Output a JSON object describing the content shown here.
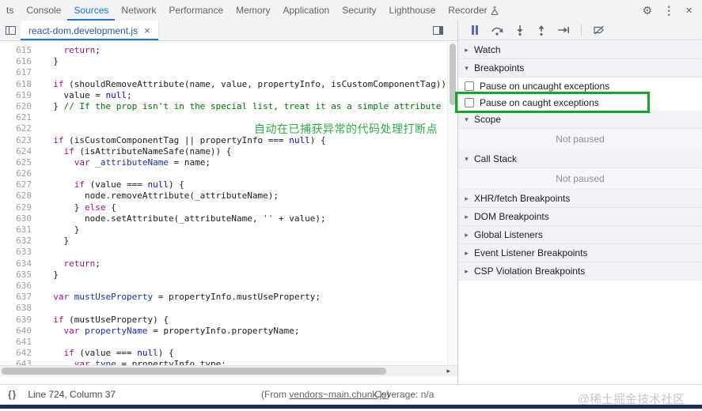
{
  "colors": {
    "accent": "#1a73e8",
    "highlight_green": "#17a527",
    "annotation_green": "#2fad44"
  },
  "top_bar": {
    "tabs": [
      {
        "label": "ts",
        "active": false
      },
      {
        "label": "Console",
        "active": false
      },
      {
        "label": "Sources",
        "active": true
      },
      {
        "label": "Network",
        "active": false
      },
      {
        "label": "Performance",
        "active": false
      },
      {
        "label": "Memory",
        "active": false
      },
      {
        "label": "Application",
        "active": false
      },
      {
        "label": "Security",
        "active": false
      },
      {
        "label": "Lighthouse",
        "active": false
      },
      {
        "label": "Recorder",
        "active": false,
        "experimental": true
      }
    ],
    "icons": {
      "settings": "⚙",
      "more": "⋮",
      "close": "×"
    }
  },
  "file_tab_bar": {
    "tab": {
      "name": "react-dom.development.js",
      "close": "×"
    }
  },
  "editor": {
    "annotation": {
      "text": "自动在已捕获异常的代码处理打断点",
      "line": 622
    },
    "lines": [
      {
        "n": 615,
        "seg": [
          [
            "p",
            "    "
          ],
          [
            "k",
            "return"
          ],
          [
            "p",
            ";"
          ]
        ]
      },
      {
        "n": 616,
        "seg": [
          [
            "p",
            "  }"
          ]
        ]
      },
      {
        "n": 617,
        "seg": []
      },
      {
        "n": 618,
        "seg": [
          [
            "p",
            "  "
          ],
          [
            "k",
            "if"
          ],
          [
            "p",
            " (shouldRemoveAttribute(name, value, propertyInfo, isCustomComponentTag)) {"
          ]
        ]
      },
      {
        "n": 619,
        "seg": [
          [
            "p",
            "    value = "
          ],
          [
            "a",
            "null"
          ],
          [
            "p",
            ";"
          ]
        ]
      },
      {
        "n": 620,
        "seg": [
          [
            "p",
            "  } "
          ],
          [
            "c",
            "// If the prop isn't in the special list, treat it as a simple attribute"
          ]
        ]
      },
      {
        "n": 621,
        "seg": []
      },
      {
        "n": 622,
        "seg": []
      },
      {
        "n": 623,
        "seg": [
          [
            "p",
            "  "
          ],
          [
            "k",
            "if"
          ],
          [
            "p",
            " (isCustomComponentTag || propertyInfo === "
          ],
          [
            "a",
            "null"
          ],
          [
            "p",
            ") {"
          ]
        ]
      },
      {
        "n": 624,
        "seg": [
          [
            "p",
            "    "
          ],
          [
            "k",
            "if"
          ],
          [
            "p",
            " (isAttributeNameSafe(name)) {"
          ]
        ]
      },
      {
        "n": 625,
        "seg": [
          [
            "p",
            "      "
          ],
          [
            "k",
            "var"
          ],
          [
            "p",
            " "
          ],
          [
            "d",
            "_attributeName"
          ],
          [
            "p",
            " = name;"
          ]
        ]
      },
      {
        "n": 626,
        "seg": []
      },
      {
        "n": 627,
        "seg": [
          [
            "p",
            "      "
          ],
          [
            "k",
            "if"
          ],
          [
            "p",
            " (value === "
          ],
          [
            "a",
            "null"
          ],
          [
            "p",
            ") {"
          ]
        ]
      },
      {
        "n": 628,
        "seg": [
          [
            "p",
            "        node.removeAttribute(_attributeName);"
          ]
        ]
      },
      {
        "n": 629,
        "seg": [
          [
            "p",
            "      } "
          ],
          [
            "k",
            "else"
          ],
          [
            "p",
            " {"
          ]
        ]
      },
      {
        "n": 630,
        "seg": [
          [
            "p",
            "        node.setAttribute(_attributeName, "
          ],
          [
            "s",
            "''"
          ],
          [
            "p",
            " + value);"
          ]
        ]
      },
      {
        "n": 631,
        "seg": [
          [
            "p",
            "      }"
          ]
        ]
      },
      {
        "n": 632,
        "seg": [
          [
            "p",
            "    }"
          ]
        ]
      },
      {
        "n": 633,
        "seg": []
      },
      {
        "n": 634,
        "seg": [
          [
            "p",
            "    "
          ],
          [
            "k",
            "return"
          ],
          [
            "p",
            ";"
          ]
        ]
      },
      {
        "n": 635,
        "seg": [
          [
            "p",
            "  }"
          ]
        ]
      },
      {
        "n": 636,
        "seg": []
      },
      {
        "n": 637,
        "seg": [
          [
            "p",
            "  "
          ],
          [
            "k",
            "var"
          ],
          [
            "p",
            " "
          ],
          [
            "d",
            "mustUseProperty"
          ],
          [
            "p",
            " = propertyInfo.mustUseProperty;"
          ]
        ]
      },
      {
        "n": 638,
        "seg": []
      },
      {
        "n": 639,
        "seg": [
          [
            "p",
            "  "
          ],
          [
            "k",
            "if"
          ],
          [
            "p",
            " (mustUseProperty) {"
          ]
        ]
      },
      {
        "n": 640,
        "seg": [
          [
            "p",
            "    "
          ],
          [
            "k",
            "var"
          ],
          [
            "p",
            " "
          ],
          [
            "d",
            "propertyName"
          ],
          [
            "p",
            " = propertyInfo.propertyName;"
          ]
        ]
      },
      {
        "n": 641,
        "seg": []
      },
      {
        "n": 642,
        "seg": [
          [
            "p",
            "    "
          ],
          [
            "k",
            "if"
          ],
          [
            "p",
            " (value === "
          ],
          [
            "a",
            "null"
          ],
          [
            "p",
            ") {"
          ]
        ]
      },
      {
        "n": 643,
        "seg": [
          [
            "p",
            "      "
          ],
          [
            "k",
            "var"
          ],
          [
            "p",
            " "
          ],
          [
            "d",
            "type"
          ],
          [
            "p",
            " = propertyInfo.type;"
          ]
        ]
      }
    ]
  },
  "sidebar": {
    "triangle_collapsed": "▸",
    "triangle_expanded": "▾",
    "sections": [
      {
        "label": "Watch",
        "expanded": false
      },
      {
        "label": "Breakpoints",
        "expanded": true,
        "items": [
          {
            "label": "Pause on uncaught exceptions",
            "checked": false
          },
          {
            "label": "Pause on caught exceptions",
            "checked": false,
            "highlighted": true
          }
        ]
      },
      {
        "label": "Scope",
        "expanded": true,
        "body": "Not paused"
      },
      {
        "label": "Call Stack",
        "expanded": true,
        "body": "Not paused"
      },
      {
        "label": "XHR/fetch Breakpoints",
        "expanded": false
      },
      {
        "label": "DOM Breakpoints",
        "expanded": false
      },
      {
        "label": "Global Listeners",
        "expanded": false
      },
      {
        "label": "Event Listener Breakpoints",
        "expanded": false
      },
      {
        "label": "CSP Violation Breakpoints",
        "expanded": false
      }
    ]
  },
  "status_bar": {
    "pretty_print": "{}",
    "position": "Line 724, Column 37",
    "from_prefix": "(From ",
    "from_link": "vendors~main.chunk.js",
    "from_suffix": ")",
    "coverage": "Coverage: n/a",
    "scroll_right_arrow": "▸"
  },
  "watermark": "@稀土掘金技术社区"
}
